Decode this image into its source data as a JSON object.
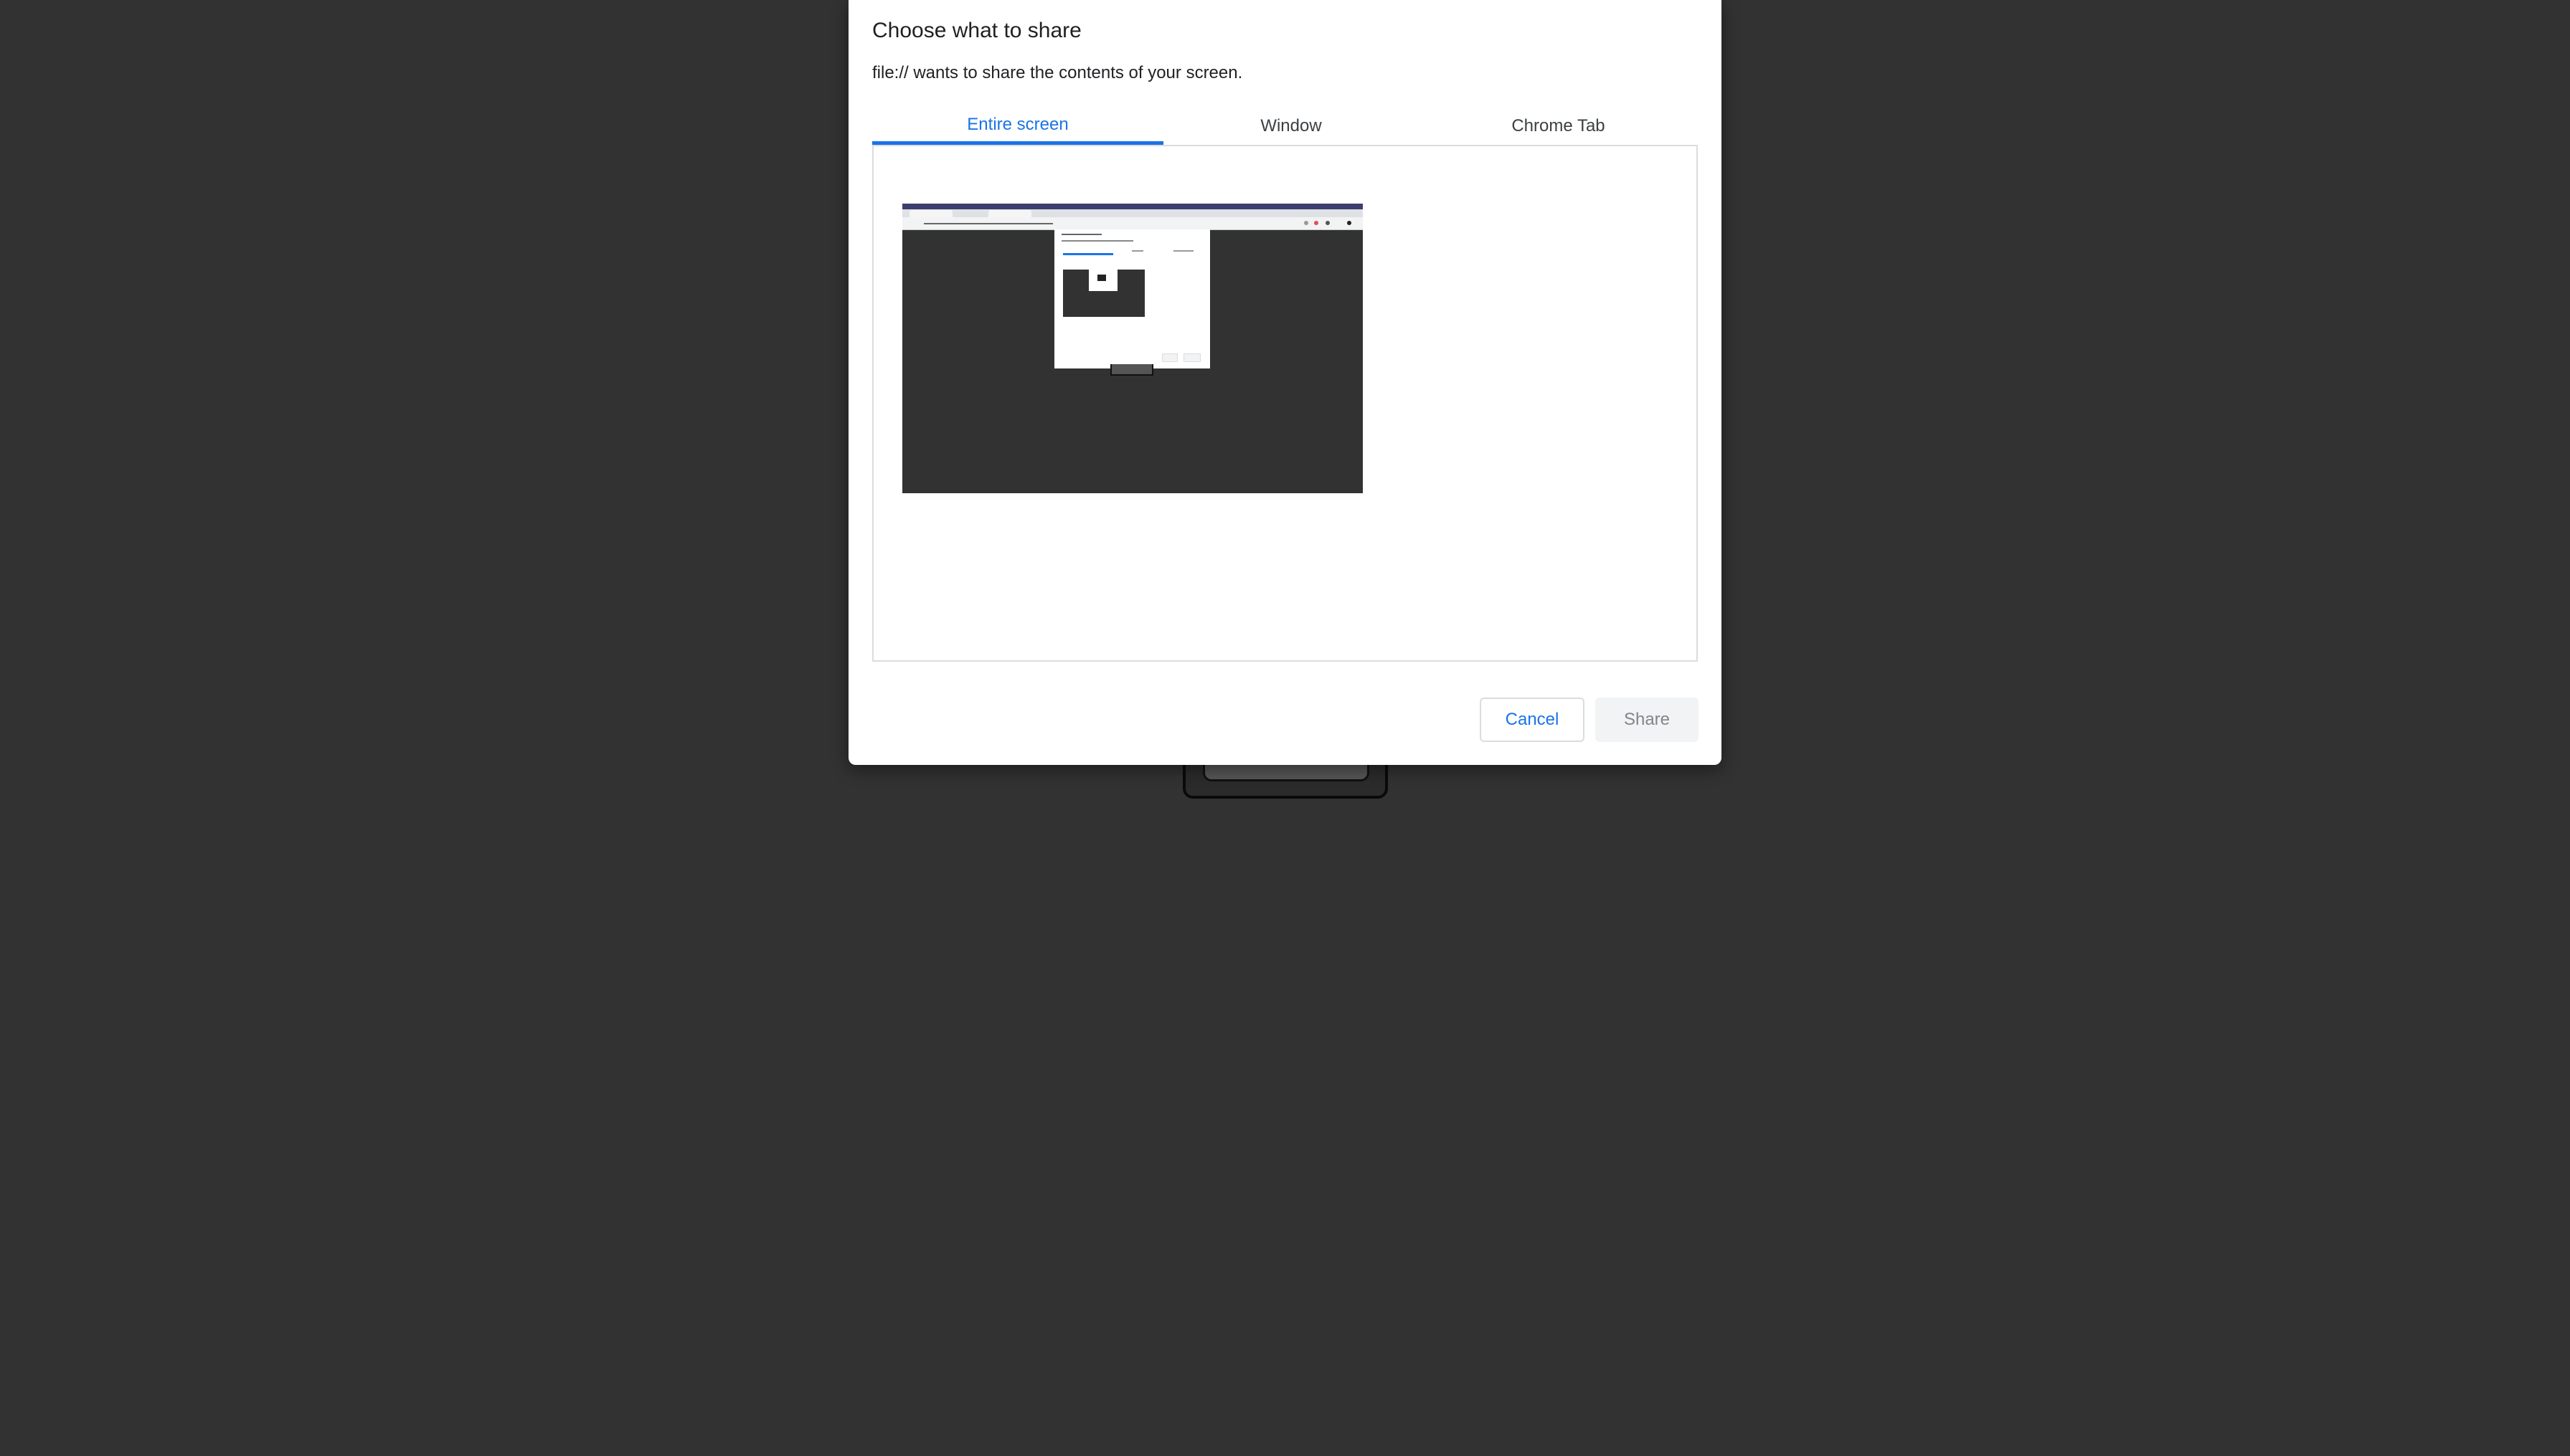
{
  "dialog": {
    "title": "Choose what to share",
    "subtitle": "file:// wants to share the contents of your screen."
  },
  "tabs": [
    {
      "label": "Entire screen",
      "active": true
    },
    {
      "label": "Window",
      "active": false
    },
    {
      "label": "Chrome Tab",
      "active": false
    }
  ],
  "buttons": {
    "cancel_label": "Cancel",
    "share_label": "Share"
  },
  "colors": {
    "accent": "#1a73e8",
    "backdrop": "#323232",
    "share_disabled_bg": "#f1f3f4",
    "share_disabled_text": "#80868b"
  }
}
